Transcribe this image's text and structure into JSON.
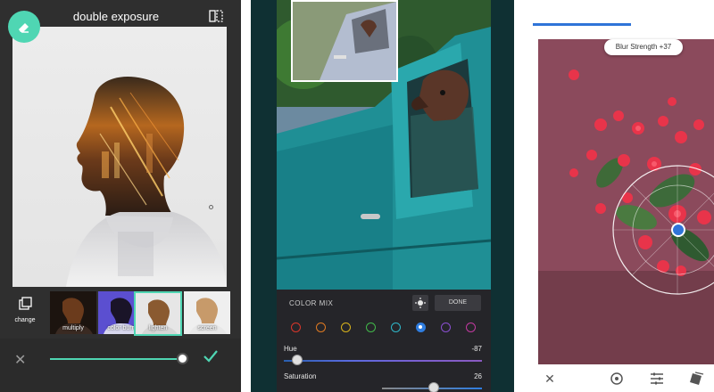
{
  "panel1": {
    "title": "double exposure",
    "change_label": "change",
    "thumbnails": [
      {
        "label": "multiply"
      },
      {
        "label": "color burn"
      },
      {
        "label": "lighten"
      },
      {
        "label": "screen"
      }
    ],
    "selected_thumbnail": "lighten",
    "opacity_level": 0.96,
    "accent": "#4fd6b3",
    "icons": [
      "eraser-icon",
      "compare-icon",
      "layers-icon",
      "close-icon",
      "check-icon"
    ]
  },
  "panel2": {
    "section_label": "COLOR MIX",
    "done_label": "DONE",
    "color_dots": [
      "#d9362b",
      "#e07a22",
      "#d9b41c",
      "#42b84a",
      "#2fb7c9",
      "#2f7de0",
      "#8a4fd1",
      "#c23aa0"
    ],
    "selected_color": "#2f7de0",
    "hue": {
      "label": "Hue",
      "value": "-87"
    },
    "saturation": {
      "label": "Saturation",
      "value": "26"
    },
    "icons": [
      "target-icon"
    ]
  },
  "panel3": {
    "badge": "Blur Strength +37",
    "accent": "#2f74d8",
    "icons": [
      "close-icon",
      "selection-icon",
      "sliders-icon",
      "styles-icon"
    ]
  }
}
